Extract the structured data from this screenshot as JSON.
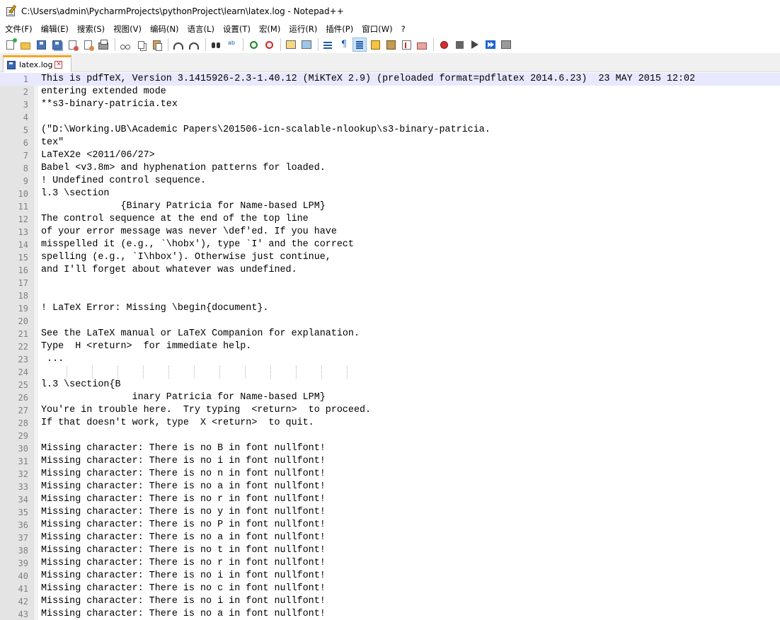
{
  "window": {
    "title": "C:\\Users\\admin\\PycharmProjects\\pythonProject\\learn\\latex.log - Notepad++"
  },
  "menu": {
    "items": [
      "文件(F)",
      "编辑(E)",
      "搜索(S)",
      "视图(V)",
      "编码(N)",
      "语言(L)",
      "设置(T)",
      "宏(M)",
      "运行(R)",
      "插件(P)",
      "窗口(W)",
      "?"
    ]
  },
  "toolbar": {
    "buttons": [
      "new-file-icon",
      "open-folder-icon",
      "save-icon",
      "save-all-icon",
      "close-icon",
      "close-all-icon",
      "print-icon",
      "cut-icon",
      "copy-icon",
      "paste-icon",
      "undo-icon",
      "redo-icon",
      "find-icon",
      "replace-icon",
      "zoom-in-icon",
      "zoom-out-icon",
      "sync-vertical-icon",
      "sync-horizontal-icon",
      "word-wrap-icon",
      "show-all-characters-icon",
      "indent-guide-icon",
      "user-language-icon",
      "document-map-icon",
      "function-list-icon",
      "folder-as-workspace-icon",
      "record-macro-icon",
      "stop-recording-icon",
      "playback-macro-icon",
      "run-macro-multiple-icon",
      "save-macro-icon"
    ],
    "active_button": "indent-guide-icon"
  },
  "tabs": [
    {
      "label": "latex.log",
      "active": true
    }
  ],
  "editor": {
    "current_line": 1,
    "lines": [
      "This is pdfTeX, Version 3.1415926-2.3-1.40.12 (MiKTeX 2.9) (preloaded format=pdflatex 2014.6.23)  23 MAY 2015 12:02",
      "entering extended mode",
      "**s3-binary-patricia.tex",
      "",
      "(\"D:\\Working.UB\\Academic Papers\\201506-icn-scalable-nlookup\\s3-binary-patricia.",
      "tex\"",
      "LaTeX2e <2011/06/27>",
      "Babel <v3.8m> and hyphenation patterns for loaded.",
      "! Undefined control sequence.",
      "l.3 \\section",
      "              {Binary Patricia for Name-based LPM}",
      "The control sequence at the end of the top line",
      "of your error message was never \\def'ed. If you have",
      "misspelled it (e.g., `\\hobx'), type `I' and the correct",
      "spelling (e.g., `I\\hbox'). Otherwise just continue,",
      "and I'll forget about whatever was undefined.",
      "",
      "",
      "! LaTeX Error: Missing \\begin{document}.",
      "",
      "See the LaTeX manual or LaTeX Companion for explanation.",
      "Type  H <return>  for immediate help.",
      " ...",
      "",
      "l.3 \\section{B",
      "                inary Patricia for Name-based LPM}",
      "You're in trouble here.  Try typing  <return>  to proceed.",
      "If that doesn't work, type  X <return>  to quit.",
      "",
      "Missing character: There is no B in font nullfont!",
      "Missing character: There is no i in font nullfont!",
      "Missing character: There is no n in font nullfont!",
      "Missing character: There is no a in font nullfont!",
      "Missing character: There is no r in font nullfont!",
      "Missing character: There is no y in font nullfont!",
      "Missing character: There is no P in font nullfont!",
      "Missing character: There is no a in font nullfont!",
      "Missing character: There is no t in font nullfont!",
      "Missing character: There is no r in font nullfont!",
      "Missing character: There is no i in font nullfont!",
      "Missing character: There is no c in font nullfont!",
      "Missing character: There is no i in font nullfont!",
      "Missing character: There is no a in font nullfont!"
    ]
  }
}
